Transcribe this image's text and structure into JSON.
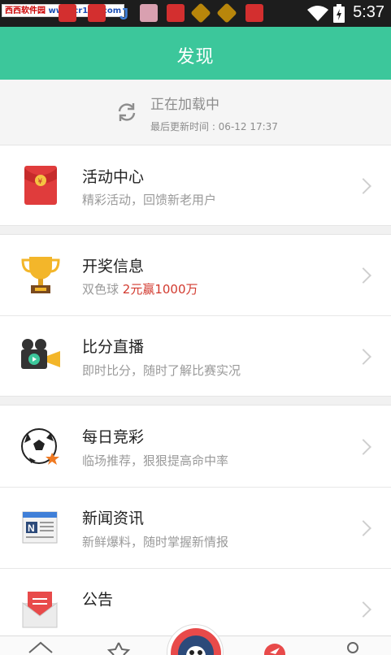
{
  "status_bar": {
    "watermark_text": "西西软件园",
    "watermark_site": "www.cr173.com",
    "time": "5:37",
    "icons": [
      "notification-app-icon",
      "j-app-icon",
      "game-app-icon",
      "lottery-app-icon",
      "wifi-icon",
      "battery-icon"
    ]
  },
  "header": {
    "title": "发现"
  },
  "loader": {
    "status": "正在加载中",
    "last_update": "最后更新时间 : 06-12 17:37"
  },
  "items": [
    {
      "title": "活动中心",
      "subtitle": "精彩活动，回馈新老用户",
      "icon": "red-envelope-icon"
    },
    {
      "title": "开奖信息",
      "subtitle_prefix": "双色球 ",
      "subtitle_highlight": "2元赢1000万",
      "icon": "trophy-icon"
    },
    {
      "title": "比分直播",
      "subtitle": "即时比分，随时了解比赛实况",
      "icon": "video-camera-icon"
    },
    {
      "title": "每日竞彩",
      "subtitle": "临场推荐，狠狠提高命中率",
      "icon": "soccer-ball-icon"
    },
    {
      "title": "新闻资讯",
      "subtitle": "新鲜爆料，随时掌握新情报",
      "icon": "newspaper-icon"
    },
    {
      "title": "公告",
      "subtitle": "",
      "icon": "mail-icon"
    }
  ],
  "colors": {
    "accent": "#3cc79b",
    "highlight": "#d23a2f"
  }
}
